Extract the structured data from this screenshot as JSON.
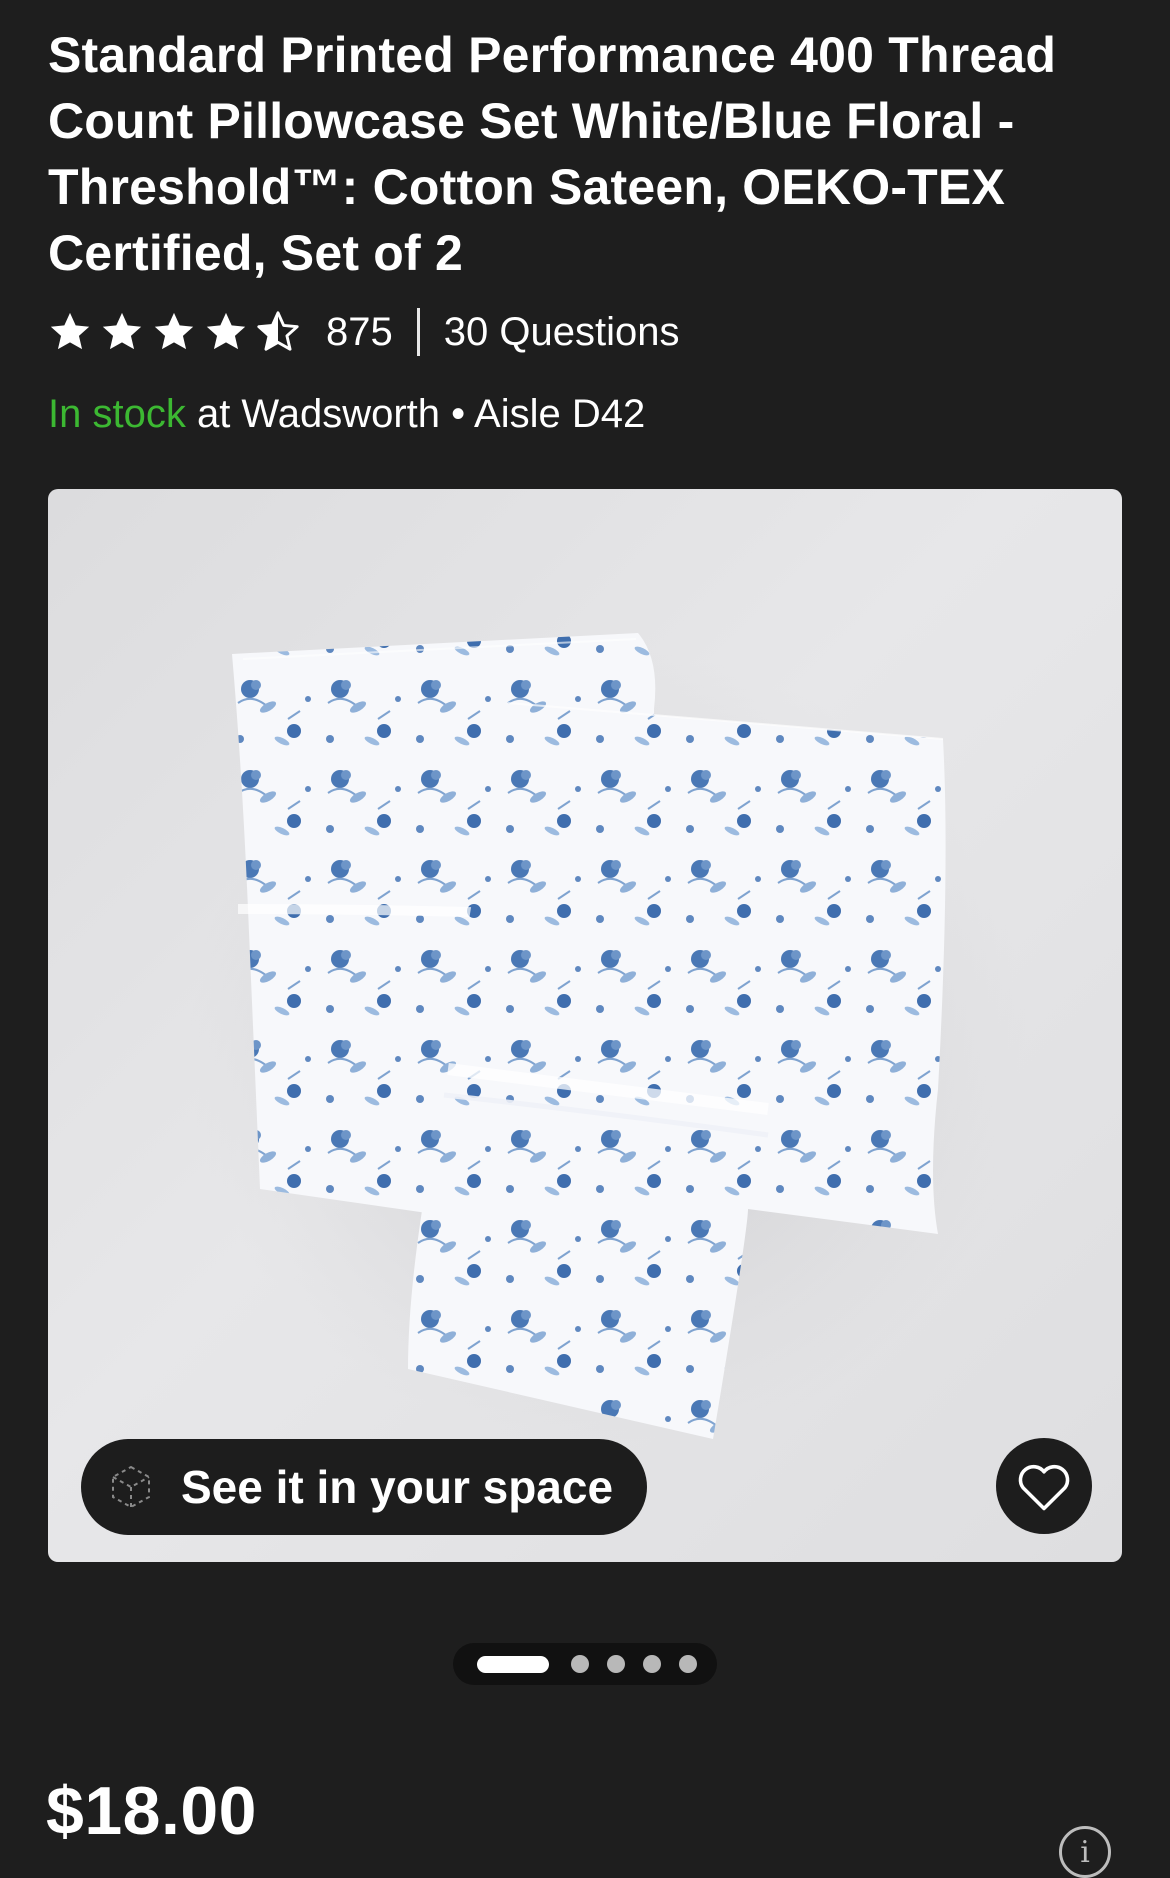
{
  "product": {
    "title": "Standard Printed Performance 400 Thread Count Pillowcase Set White/Blue Floral - Threshold™: Cotton Sateen, OEKO-TEX Certified, Set of 2",
    "rating": {
      "stars": 4.5,
      "max_stars": 5,
      "review_count": "875",
      "questions_label": "30 Questions"
    },
    "availability": {
      "status": "In stock",
      "location": " at Wadsworth • Aisle D42",
      "status_color": "#3cb832"
    },
    "image": {
      "alt": "pillowcase-set-image",
      "see_in_space_label": "See it in your space",
      "favorite_icon": "heart-icon",
      "ar_icon": "cube-ar-icon"
    },
    "carousel": {
      "total": 5,
      "active_index": 0
    },
    "price": "$18.00",
    "info_glyph": "i"
  },
  "colors": {
    "background": "#1e1e1e",
    "accent_green": "#3cb832",
    "pattern_blue": "#4a78b5"
  }
}
